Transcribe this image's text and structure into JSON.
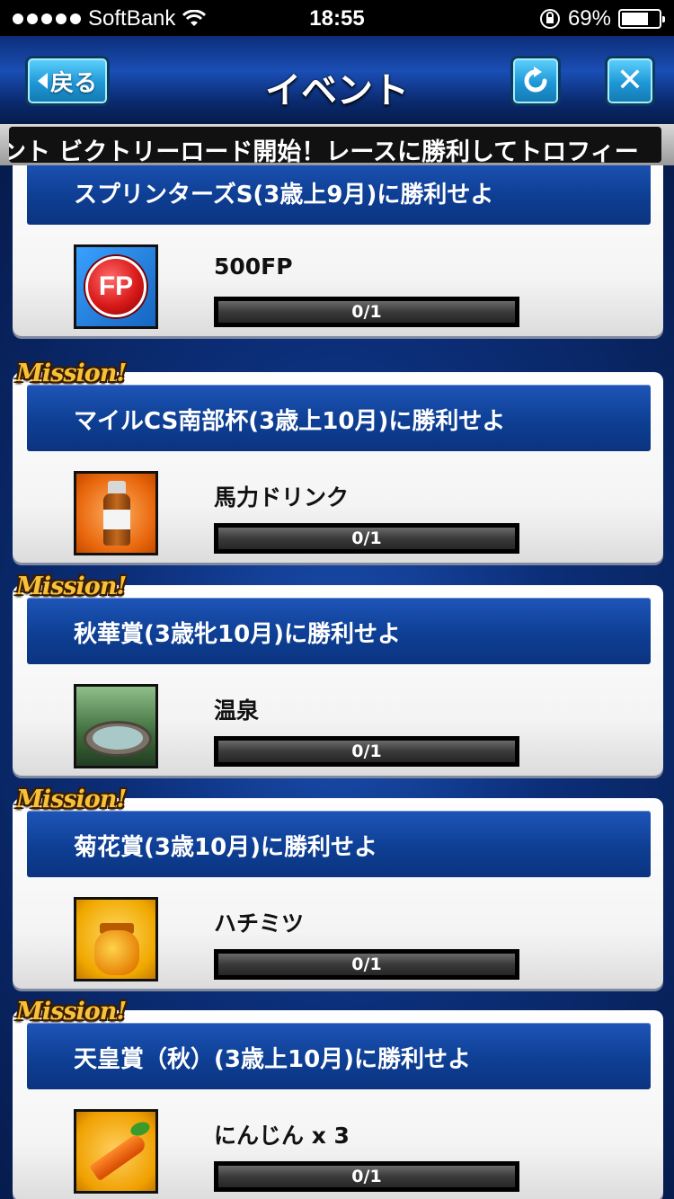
{
  "status_bar": {
    "carrier": "SoftBank",
    "time": "18:55",
    "battery": "69%"
  },
  "header": {
    "back_label": "戻る",
    "title": "イベント",
    "close_label": "✕",
    "refresh_label": "⟳"
  },
  "ticker": {
    "text": "ント ビクトリーロード開始！レースに勝利してトロフィー"
  },
  "badge_label": "Mission!",
  "missions": [
    {
      "title": "スプリンターズS(3歳上9月)に勝利せよ",
      "reward": "500FP",
      "progress": "0/1",
      "icon": "fp-coin-icon"
    },
    {
      "title": "マイルCS南部杯(3歳上10月)に勝利せよ",
      "reward": "馬力ドリンク",
      "progress": "0/1",
      "icon": "drink-bottle-icon"
    },
    {
      "title": "秋華賞(3歳牝10月)に勝利せよ",
      "reward": "温泉",
      "progress": "0/1",
      "icon": "hot-spring-icon"
    },
    {
      "title": "菊花賞(3歳10月)に勝利せよ",
      "reward": "ハチミツ",
      "progress": "0/1",
      "icon": "honey-jar-icon"
    },
    {
      "title": "天皇賞（秋）(3歳上10月)に勝利せよ",
      "reward": "にんじん x 3",
      "progress": "0/1",
      "icon": "carrot-icon"
    }
  ],
  "fp_icon_text": "FP",
  "colors": {
    "mission_bar": "#0e3f94",
    "button_accent": "#1e97d6",
    "badge_gold": "#f7c23a"
  }
}
